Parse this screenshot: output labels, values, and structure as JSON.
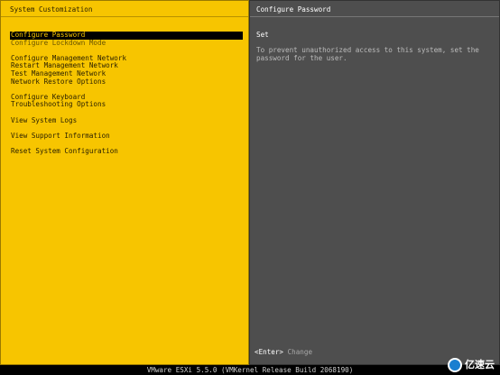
{
  "left_title": "System Customization",
  "right_title": "Configure Password",
  "menu": [
    {
      "label": "Configure Password",
      "state": "selected"
    },
    {
      "label": "Configure Lockdown Mode",
      "state": "dim"
    },
    {
      "gap": true
    },
    {
      "label": "Configure Management Network"
    },
    {
      "label": "Restart Management Network"
    },
    {
      "label": "Test Management Network"
    },
    {
      "label": "Network Restore Options"
    },
    {
      "gap": true
    },
    {
      "label": "Configure Keyboard"
    },
    {
      "label": "Troubleshooting Options"
    },
    {
      "gap": true
    },
    {
      "label": "View System Logs"
    },
    {
      "gap": true
    },
    {
      "label": "View Support Information"
    },
    {
      "gap": true
    },
    {
      "label": "Reset System Configuration"
    }
  ],
  "detail": {
    "heading": "Set",
    "description": "To prevent unauthorized access to this system, set the\npassword for the user."
  },
  "hint": {
    "key": "<Enter>",
    "action": "Change"
  },
  "status_bar": "VMware ESXi 5.5.0 (VMKernel Release Build 2068190)",
  "watermark": "亿速云",
  "colors": {
    "left_bg": "#f7c500",
    "right_bg": "#4e4e4e",
    "selected_bg": "#000000",
    "watermark_logo": "#1a7fd0"
  }
}
